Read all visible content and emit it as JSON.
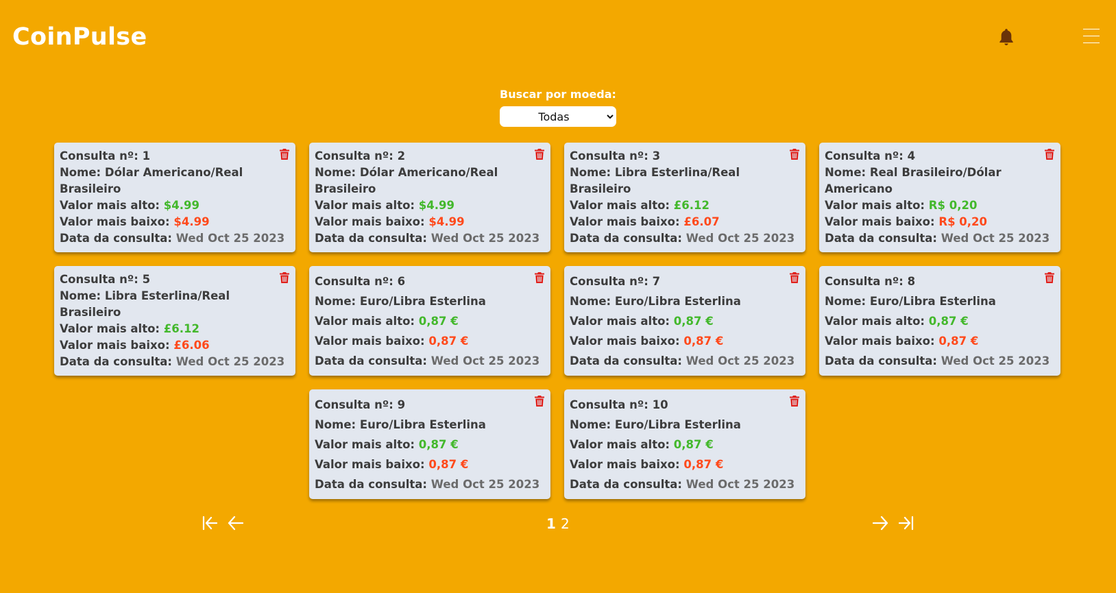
{
  "app": {
    "title": "CoinPulse"
  },
  "header": {
    "bell_icon": "bell-icon",
    "menu_icon": "hamburger-menu-icon"
  },
  "filter": {
    "label": "Buscar por moeda:",
    "selected": "Todas"
  },
  "labels": {
    "consulta": "Consulta nº:",
    "nome": "Nome:",
    "alto": "Valor mais alto:",
    "baixo": "Valor mais baixo:",
    "data": "Data da consulta:"
  },
  "cards": [
    {
      "numero": "1",
      "nome": "Dólar Americano/Real Brasileiro",
      "alto": "$4.99",
      "baixo": "$4.99",
      "data": "Wed Oct 25 2023"
    },
    {
      "numero": "2",
      "nome": "Dólar Americano/Real Brasileiro",
      "alto": "$4.99",
      "baixo": "$4.99",
      "data": "Wed Oct 25 2023"
    },
    {
      "numero": "3",
      "nome": "Libra Esterlina/Real Brasileiro",
      "alto": "£6.12",
      "baixo": "£6.07",
      "data": "Wed Oct 25 2023"
    },
    {
      "numero": "4",
      "nome": "Real Brasileiro/Dólar Americano",
      "alto": "R$ 0,20",
      "baixo": "R$ 0,20",
      "data": "Wed Oct 25 2023"
    },
    {
      "numero": "5",
      "nome": "Libra Esterlina/Real Brasileiro",
      "alto": "£6.12",
      "baixo": "£6.06",
      "data": "Wed Oct 25 2023"
    },
    {
      "numero": "6",
      "nome": "Euro/Libra Esterlina",
      "alto": "0,87 €",
      "baixo": "0,87 €",
      "data": "Wed Oct 25 2023"
    },
    {
      "numero": "7",
      "nome": "Euro/Libra Esterlina",
      "alto": "0,87 €",
      "baixo": "0,87 €",
      "data": "Wed Oct 25 2023"
    },
    {
      "numero": "8",
      "nome": "Euro/Libra Esterlina",
      "alto": "0,87 €",
      "baixo": "0,87 €",
      "data": "Wed Oct 25 2023"
    },
    {
      "numero": "9",
      "nome": "Euro/Libra Esterlina",
      "alto": "0,87 €",
      "baixo": "0,87 €",
      "data": "Wed Oct 25 2023"
    },
    {
      "numero": "10",
      "nome": "Euro/Libra Esterlina",
      "alto": "0,87 €",
      "baixo": "0,87 €",
      "data": "Wed Oct 25 2023"
    }
  ],
  "pagination": {
    "pages": [
      "1",
      "2"
    ],
    "current": "1"
  },
  "colors": {
    "background": "#f3a800",
    "card": "#e2e7ef",
    "high": "#43b82c",
    "low": "#ff4a1c",
    "trash": "#e0201b"
  }
}
